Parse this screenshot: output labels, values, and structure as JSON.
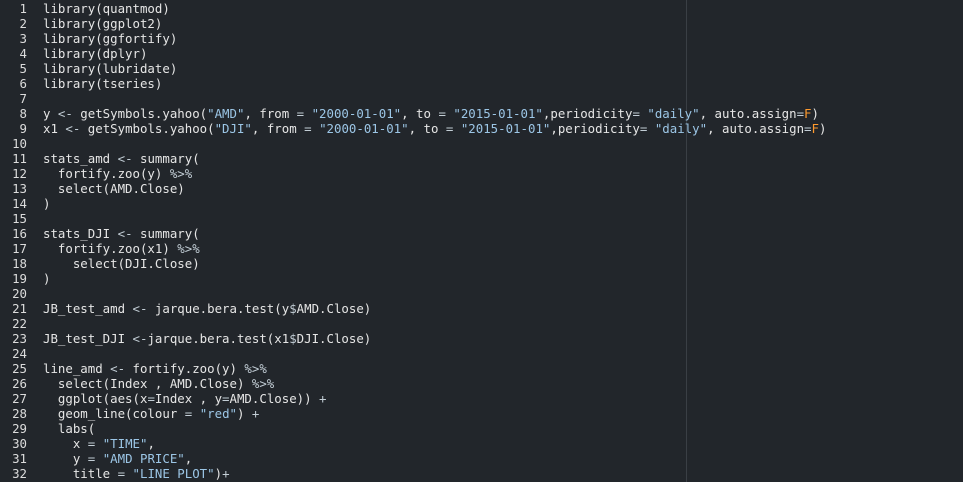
{
  "editor": {
    "lines": [
      {
        "n": "1",
        "text": "library(quantmod)"
      },
      {
        "n": "2",
        "text": "library(ggplot2)"
      },
      {
        "n": "3",
        "text": "library(ggfortify)"
      },
      {
        "n": "4",
        "text": "library(dplyr)"
      },
      {
        "n": "5",
        "text": "library(lubridate)"
      },
      {
        "n": "6",
        "text": "library(tseries)"
      },
      {
        "n": "7",
        "text": ""
      },
      {
        "n": "8",
        "text": "y <- getSymbols.yahoo(\"AMD\", from = \"2000-01-01\", to = \"2015-01-01\",periodicity= \"daily\", auto.assign=F)"
      },
      {
        "n": "9",
        "text": "x1 <- getSymbols.yahoo(\"DJI\", from = \"2000-01-01\", to = \"2015-01-01\",periodicity= \"daily\", auto.assign=F)"
      },
      {
        "n": "10",
        "text": ""
      },
      {
        "n": "11",
        "text": "stats_amd <- summary("
      },
      {
        "n": "12",
        "text": "  fortify.zoo(y) %>%"
      },
      {
        "n": "13",
        "text": "  select(AMD.Close)"
      },
      {
        "n": "14",
        "text": ")"
      },
      {
        "n": "15",
        "text": ""
      },
      {
        "n": "16",
        "text": "stats_DJI <- summary("
      },
      {
        "n": "17",
        "text": "  fortify.zoo(x1) %>%"
      },
      {
        "n": "18",
        "text": "    select(DJI.Close)"
      },
      {
        "n": "19",
        "text": ")"
      },
      {
        "n": "20",
        "text": ""
      },
      {
        "n": "21",
        "text": "JB_test_amd <- jarque.bera.test(y$AMD.Close)"
      },
      {
        "n": "22",
        "text": ""
      },
      {
        "n": "23",
        "text": "JB_test_DJI <-jarque.bera.test(x1$DJI.Close)"
      },
      {
        "n": "24",
        "text": ""
      },
      {
        "n": "25",
        "text": "line_amd <- fortify.zoo(y) %>%"
      },
      {
        "n": "26",
        "text": "  select(Index , AMD.Close) %>%"
      },
      {
        "n": "27",
        "text": "  ggplot(aes(x=Index , y=AMD.Close)) +"
      },
      {
        "n": "28",
        "text": "  geom_line(colour = \"red\") +"
      },
      {
        "n": "29",
        "text": "  labs("
      },
      {
        "n": "30",
        "text": "    x = \"TIME\","
      },
      {
        "n": "31",
        "text": "    y = \"AMD PRICE\","
      },
      {
        "n": "32",
        "text": "    title = \"LINE PLOT\")+"
      }
    ]
  },
  "colors": {
    "background": "#22262b",
    "line_number": "#dcdcdc",
    "string": "#9cc6e6",
    "keyword": "#ff9a2e",
    "text": "#e6e6e6",
    "margin_line": "#3a3f45"
  }
}
